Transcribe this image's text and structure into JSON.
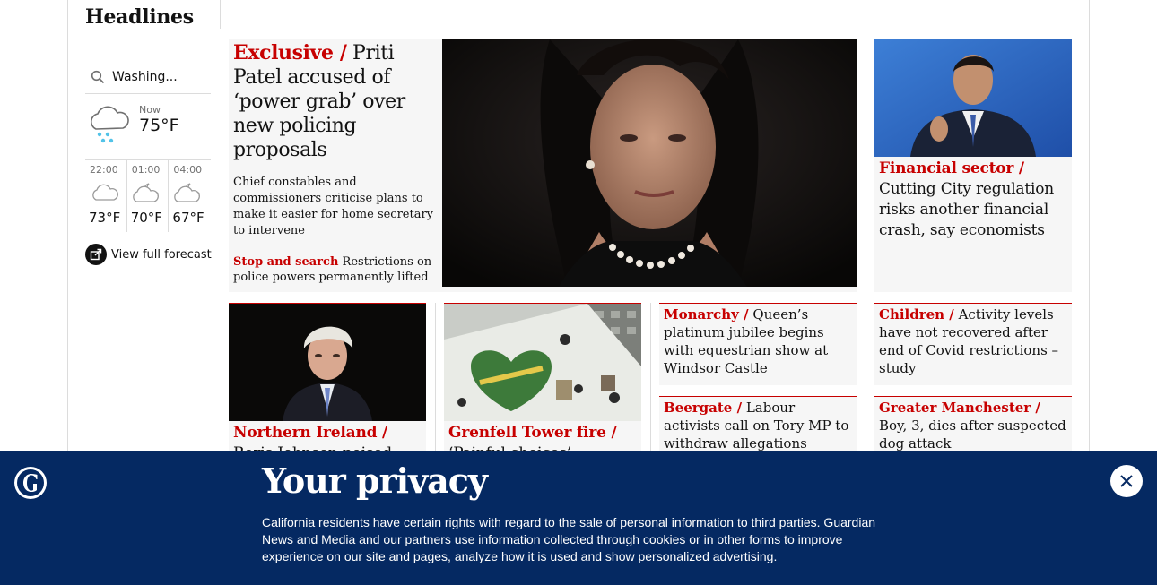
{
  "section": {
    "title": "Headlines"
  },
  "weather": {
    "location": "Washing...",
    "now_label": "Now",
    "now_temp": "75°F",
    "forecast": [
      {
        "time": "22:00",
        "temp": "73°F",
        "icon": "cloudy-night-icon"
      },
      {
        "time": "01:00",
        "temp": "70°F",
        "icon": "partly-cloudy-night-icon"
      },
      {
        "time": "04:00",
        "temp": "67°F",
        "icon": "partly-cloudy-night-icon"
      }
    ],
    "full_forecast_label": "View full forecast"
  },
  "main_story": {
    "kicker": "Exclusive /",
    "headline": "Priti Patel accused of ‘power grab’ over new policing proposals",
    "standfirst": "Chief constables and commissioners criticise plans to make it easier for home secretary to intervene",
    "sublink_kicker": "Stop and search",
    "sublink_text": "Restrictions on police powers permanently lifted"
  },
  "right_story": {
    "kicker": "Financial sector /",
    "headline": "Cutting City regulation risks another financial crash, say economists"
  },
  "row2": {
    "story1": {
      "kicker": "Northern Ireland /",
      "headline": "Boris Johnson poised"
    },
    "story2": {
      "kicker": "Grenfell Tower fire /",
      "headline": "‘Painful choices’"
    },
    "story3": {
      "kicker": "Monarchy /",
      "headline": "Queen’s platinum jubilee begins with equestrian show at Windsor Castle"
    },
    "story4": {
      "kicker": "Beergate /",
      "headline": "Labour activists call on Tory MP to withdraw allegations"
    },
    "story5": {
      "kicker": "Children /",
      "headline": "Activity levels have not recovered after end of Covid restrictions – study"
    },
    "story6": {
      "kicker": "Greater Manchester /",
      "headline": "Boy, 3, dies after suspected dog attack"
    }
  },
  "privacy": {
    "title": "Your privacy",
    "body": "California residents have certain rights with regard to the sale of personal information to third parties. Guardian News and Media and our partners use information collected through cookies or in other forms to improve experience on our site and pages, analyze how it is used and show personalized advertising."
  },
  "colors": {
    "kicker": "#c70000",
    "banner": "#052962",
    "card_bg": "#f6f6f6"
  }
}
